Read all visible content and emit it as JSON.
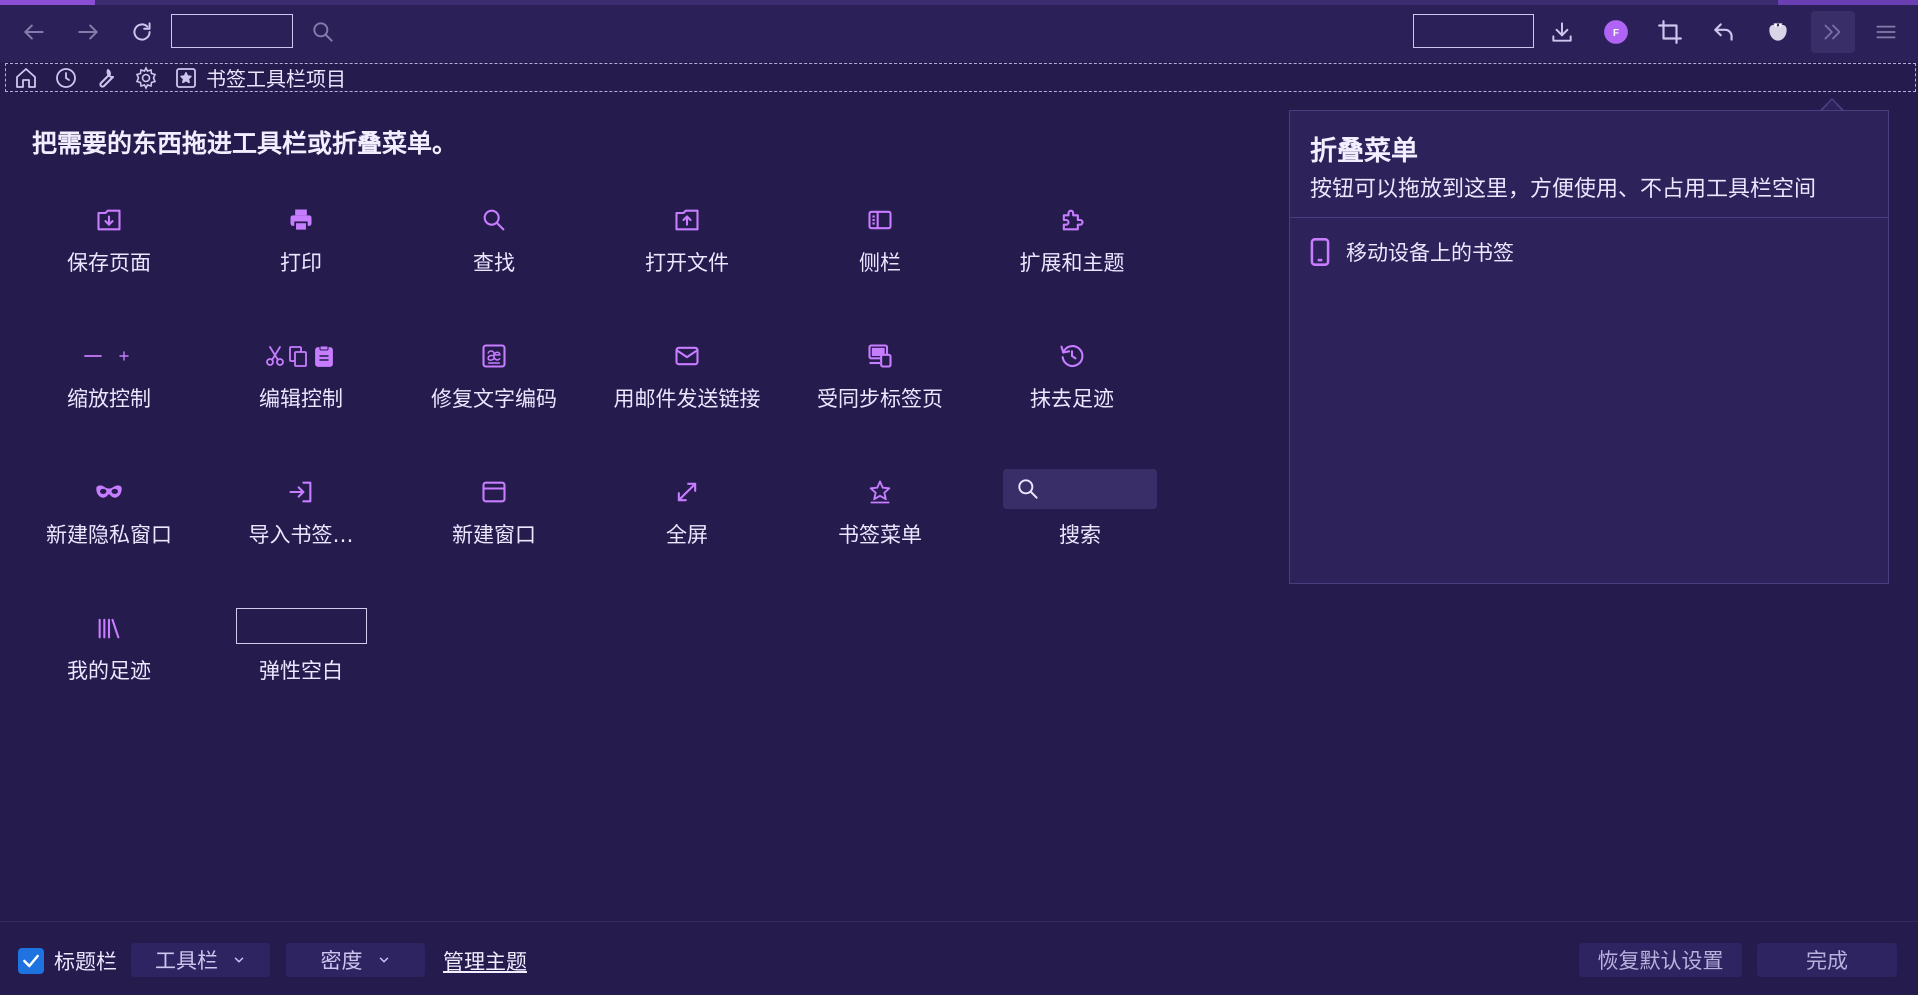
{
  "colors": {
    "accent": "#c77dff",
    "background": "#251b4d",
    "toolbar": "#2b2057",
    "panel": "#2d2259",
    "checkbox": "#1f73e0"
  },
  "nav": {
    "back_icon": "arrow-left-icon",
    "forward_icon": "arrow-right-icon",
    "reload_icon": "reload-icon",
    "search_icon": "search-icon",
    "downloads_icon": "download-icon",
    "account_icon": "account-icon",
    "account_letter": "F",
    "screenshot_icon": "crop-icon",
    "undo_icon": "undo-icon",
    "extension_icon": "flower-icon",
    "overflow_icon": "chevrons-right-icon",
    "menu_icon": "hamburger-menu-icon"
  },
  "bookmarks_toolbar": {
    "items_label": "书签工具栏项目"
  },
  "palette": {
    "title": "把需要的东西拖进工具栏或折叠菜单。",
    "items": [
      {
        "label": "保存页面",
        "icon": "save-page-icon"
      },
      {
        "label": "打印",
        "icon": "print-icon"
      },
      {
        "label": "查找",
        "icon": "find-icon"
      },
      {
        "label": "打开文件",
        "icon": "open-file-icon"
      },
      {
        "label": "侧栏",
        "icon": "sidebar-icon"
      },
      {
        "label": "扩展和主题",
        "icon": "puzzle-icon"
      },
      {
        "label": "缩放控制",
        "icon": "zoom-controls-icon"
      },
      {
        "label": "编辑控制",
        "icon": "edit-controls-icon"
      },
      {
        "label": "修复文字编码",
        "icon": "text-encoding-icon"
      },
      {
        "label": "用邮件发送链接",
        "icon": "email-icon"
      },
      {
        "label": "受同步标签页",
        "icon": "synced-tabs-icon"
      },
      {
        "label": "抹去足迹",
        "icon": "forget-icon"
      },
      {
        "label": "新建隐私窗口",
        "icon": "private-mask-icon"
      },
      {
        "label": "导入书签…",
        "icon": "import-icon"
      },
      {
        "label": "新建窗口",
        "icon": "new-window-icon"
      },
      {
        "label": "全屏",
        "icon": "fullscreen-icon"
      },
      {
        "label": "书签菜单",
        "icon": "bookmark-star-icon"
      },
      {
        "label": "搜索",
        "icon": "search-icon"
      },
      {
        "label": "我的足迹",
        "icon": "library-icon"
      },
      {
        "label": "弹性空白",
        "icon": "flexible-space"
      }
    ]
  },
  "overflow_panel": {
    "title": "折叠菜单",
    "description": "按钮可以拖放到这里，方便使用、不占用工具栏空间",
    "items": [
      {
        "label": "移动设备上的书签",
        "icon": "mobile-device-icon"
      }
    ]
  },
  "footer": {
    "titlebar_checkbox_label": "标题栏",
    "titlebar_checked": true,
    "toolbars_dropdown": "工具栏",
    "density_dropdown": "密度",
    "manage_themes": "管理主题",
    "restore_defaults": "恢复默认设置",
    "done": "完成"
  }
}
